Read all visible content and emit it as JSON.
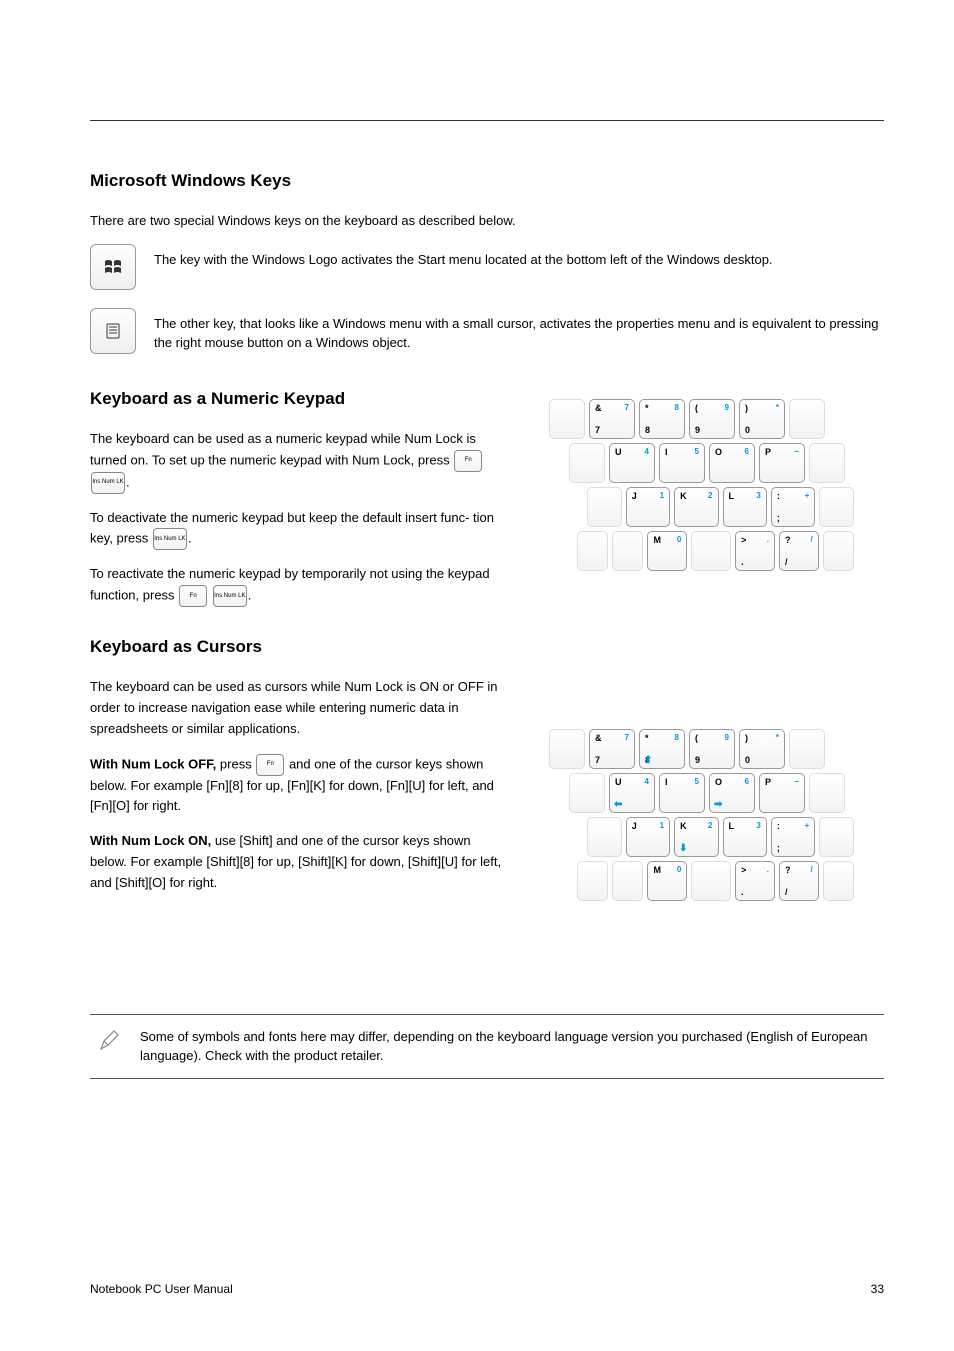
{
  "header": {
    "title": "Microsoft Windows Keys"
  },
  "intro": "There are two special Windows keys on the keyboard as described below.",
  "winkey": {
    "text": "The key with the Windows Logo activates the Start menu located at the bottom left of the Windows desktop."
  },
  "menukey": {
    "text": "The other key, that looks like a Windows menu with a small cursor, activates the properties menu and is equivalent to pressing the right mouse button on a Windows object."
  },
  "numeric": {
    "title": "Keyboard as a Numeric Keypad",
    "p1": "The keyboard can be used as a numeric keypad while",
    "p1b": "",
    "p1c": "Num Lock is turned on. To set up the numeric keypad with Num Lock,",
    "p1d": "",
    "p1e": "press",
    "p1f": "To deactivate the numeric keypad but keep the default insert func-",
    "p1g": "tion",
    "p1h": "key, press",
    "p1i": "To reactivate the numeric keypad by temporarily not using the",
    "p1j": "keypad function, press"
  },
  "cursors": {
    "title": "Keyboard as Cursors",
    "p1": "The keyboard can be used as cursors while Num Lock is ON or OFF in order to increase navigation ease while entering numeric data in spreadsheets or similar applications.",
    "p2a": "With Num Lock OFF,",
    "p2b": "press",
    "p2c": "and one of the cursor keys shown below. For example [Fn][8] for up, [Fn][K] for down, [Fn][U] for left, and [Fn][O] for right.",
    "p3": "With Num Lock ON,",
    "p3b": "use [Shift] and one of the cursor keys shown below. For example [Shift][8] for up, [Shift][K] for down, [Shift][U] for left, and [Shift][O] for right."
  },
  "keylabels": {
    "fn": "Fn",
    "ins_num": "Ins\nNum LK"
  },
  "diag1": {
    "row1": [
      {
        "tl": "&",
        "tr": "7",
        "bl": "7"
      },
      {
        "tl": "*",
        "tr": "8",
        "bl": "8"
      },
      {
        "tl": "(",
        "tr": "9",
        "bl": "9"
      },
      {
        "tl": ")",
        "tr": "*",
        "bl": "0"
      }
    ],
    "row2": [
      {
        "tl": "U",
        "tr": "4"
      },
      {
        "tl": "I",
        "tr": "5"
      },
      {
        "tl": "O",
        "tr": "6"
      },
      {
        "tl": "P",
        "tr": "−"
      }
    ],
    "row3": [
      {
        "tl": "J",
        "tr": "1"
      },
      {
        "tl": "K",
        "tr": "2"
      },
      {
        "tl": "L",
        "tr": "3"
      },
      {
        "tl": ":",
        "tr": "+",
        "bl": ";"
      }
    ],
    "row4": [
      {
        "tl": "M",
        "tr": "0"
      },
      {},
      {
        "tl": ">",
        "tr": ".",
        "bl": "."
      },
      {
        "tl": "?",
        "tr": "/",
        "bl": "/"
      }
    ]
  },
  "diag2": {
    "row1": [
      {
        "tl": "&",
        "tr": "7",
        "bl": "7"
      },
      {
        "tl": "*",
        "tr": "8",
        "bl": "8",
        "arrow": "⬆"
      },
      {
        "tl": "(",
        "tr": "9",
        "bl": "9"
      },
      {
        "tl": ")",
        "tr": "*",
        "bl": "0"
      }
    ],
    "row2": [
      {
        "tl": "U",
        "tr": "4",
        "arrow": "⬅"
      },
      {
        "tl": "I",
        "tr": "5"
      },
      {
        "tl": "O",
        "tr": "6",
        "arrow": "➡"
      },
      {
        "tl": "P",
        "tr": "−"
      }
    ],
    "row3": [
      {
        "tl": "J",
        "tr": "1"
      },
      {
        "tl": "K",
        "tr": "2",
        "arrow": "⬇"
      },
      {
        "tl": "L",
        "tr": "3"
      },
      {
        "tl": ":",
        "tr": "+",
        "bl": ";"
      }
    ],
    "row4": [
      {
        "tl": "M",
        "tr": "0"
      },
      {},
      {
        "tl": ">",
        "tr": ".",
        "bl": "."
      },
      {
        "tl": "?",
        "tr": "/",
        "bl": "/"
      }
    ]
  },
  "note": {
    "text": "Some of symbols and fonts here may differ, depending on the keyboard language version you purchased (English of European language). Check with the product retailer."
  },
  "footer": {
    "left": "Notebook PC User Manual",
    "right": "33"
  }
}
